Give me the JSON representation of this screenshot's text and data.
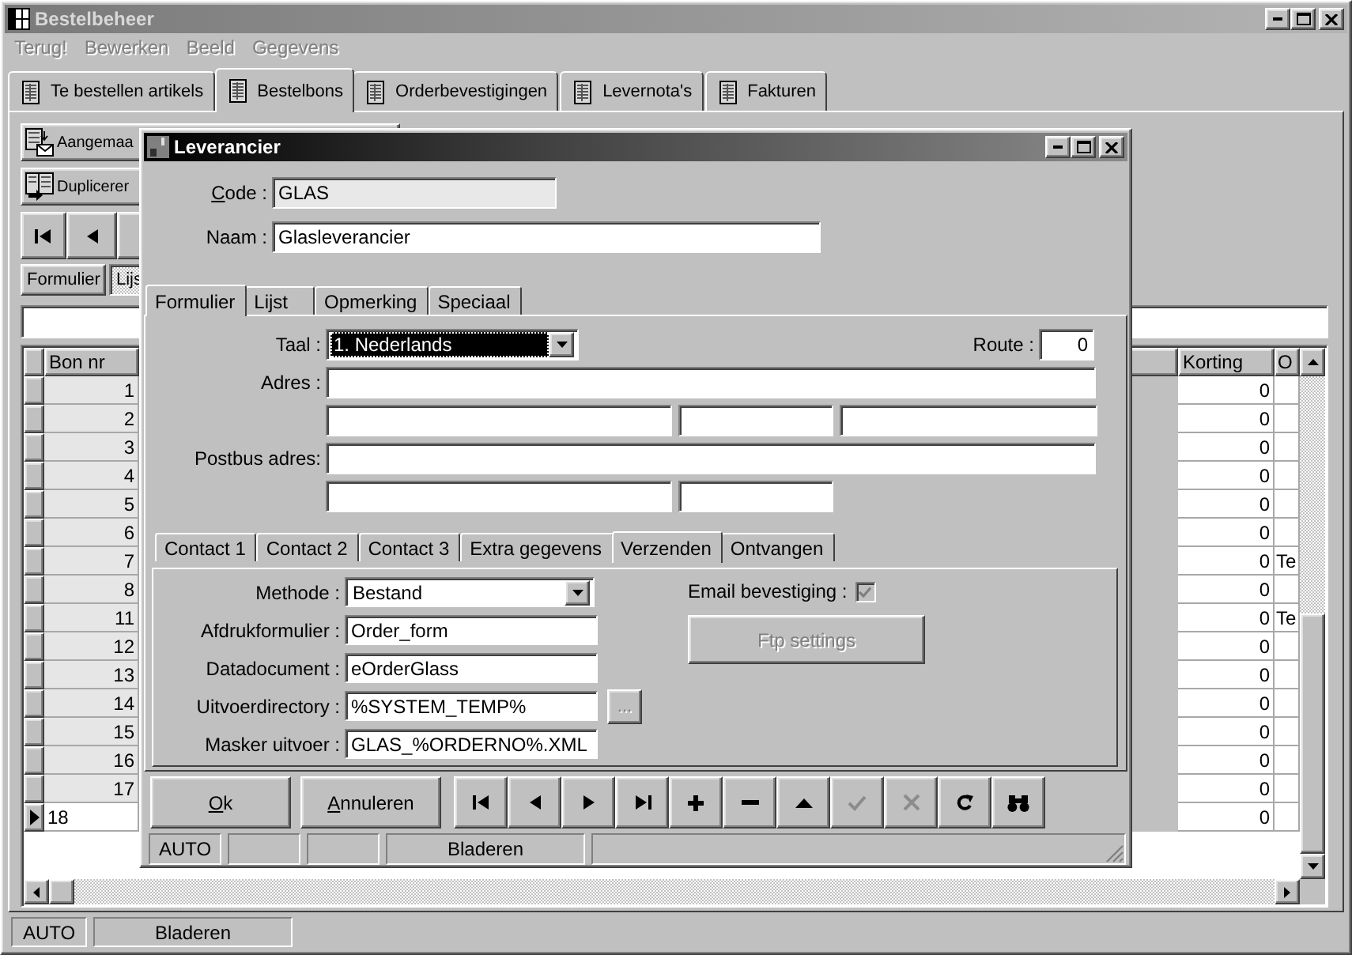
{
  "window": {
    "title": "Bestelbeheer",
    "active": false
  },
  "menu": [
    {
      "label": "Terug!",
      "disabled": true
    },
    {
      "label": "Bewerken",
      "disabled": true
    },
    {
      "label": "Beeld",
      "disabled": true
    },
    {
      "label": "Gegevens",
      "disabled": true
    }
  ],
  "tabs": [
    {
      "label": "Te bestellen artikels",
      "selected": false
    },
    {
      "label": "Bestelbons",
      "selected": true
    },
    {
      "label": "Orderbevestigingen",
      "selected": false
    },
    {
      "label": "Levernota's",
      "selected": false
    },
    {
      "label": "Fakturen",
      "selected": false
    }
  ],
  "toolbar": [
    {
      "kind": "create",
      "label": "Aangemaa"
    },
    {
      "kind": "duplicate",
      "label": "Duplicerer"
    }
  ],
  "record_nav": [
    {
      "kind": "first"
    },
    {
      "kind": "prev"
    }
  ],
  "view_tabs": [
    {
      "label": "Formulier",
      "selected": false
    },
    {
      "label": "Lijs",
      "selected": true
    }
  ],
  "grid": {
    "columns": [
      "Bon nr",
      "Korting",
      "O"
    ],
    "rows": [
      {
        "bon_nr": "1",
        "korting": "0",
        "current": false
      },
      {
        "bon_nr": "2",
        "korting": "0",
        "current": false
      },
      {
        "bon_nr": "3",
        "korting": "0",
        "current": false
      },
      {
        "bon_nr": "4",
        "korting": "0",
        "current": false
      },
      {
        "bon_nr": "5",
        "korting": "0",
        "current": false
      },
      {
        "bon_nr": "6",
        "korting": "0",
        "current": false
      },
      {
        "bon_nr": "7",
        "korting": "0",
        "column_3": "Te",
        "current": false
      },
      {
        "bon_nr": "8",
        "korting": "0",
        "current": false
      },
      {
        "bon_nr": "11",
        "korting": "0",
        "column_3": "Te",
        "current": false
      },
      {
        "bon_nr": "12",
        "korting": "0",
        "current": false
      },
      {
        "bon_nr": "13",
        "korting": "0",
        "current": false
      },
      {
        "bon_nr": "14",
        "korting": "0",
        "current": false
      },
      {
        "bon_nr": "15",
        "korting": "0",
        "current": false
      },
      {
        "bon_nr": "16",
        "korting": "0",
        "current": false
      },
      {
        "bon_nr": "17",
        "korting": "0",
        "current": false
      },
      {
        "bon_nr": "18",
        "korting": "0",
        "current": true
      }
    ]
  },
  "status_bar": {
    "mode": "AUTO",
    "state": "Bladeren"
  },
  "dialog": {
    "title": "Leverancier",
    "active": true,
    "code": {
      "label": "Code :",
      "value": "GLAS",
      "readonly": true,
      "mnemonic": true
    },
    "naam": {
      "label": "Naam :",
      "value": "Glasleverancier",
      "readonly": false,
      "mnemonic": false
    },
    "tabs": [
      {
        "label": "Formulier",
        "selected": true
      },
      {
        "label": "Lijst",
        "selected": false
      },
      {
        "label": "Opmerking",
        "selected": false
      },
      {
        "label": "Speciaal",
        "selected": false
      }
    ],
    "taal": {
      "label": "Taal :",
      "value": "1.  Nederlands",
      "focused": true
    },
    "route": {
      "label": "Route :",
      "value": "0"
    },
    "adres": {
      "label": "Adres :"
    },
    "postbus": {
      "label": "Postbus adres:"
    },
    "sub_tabs": [
      {
        "label": "Contact 1",
        "selected": false
      },
      {
        "label": "Contact 2",
        "selected": false
      },
      {
        "label": "Contact 3",
        "selected": false
      },
      {
        "label": "Extra gegevens",
        "selected": false
      },
      {
        "label": "Verzenden",
        "selected": true
      },
      {
        "label": "Ontvangen",
        "selected": false
      }
    ],
    "send_fields": [
      {
        "kind": "dropdown",
        "label": "Methode :",
        "value": "Bestand"
      },
      {
        "kind": "text",
        "label": "Afdrukformulier :",
        "value": "Order_form"
      },
      {
        "kind": "text",
        "label": "Datadocument :",
        "value": "eOrderGlass"
      },
      {
        "kind": "browse",
        "label": "Uitvoerdirectory :",
        "value": "%SYSTEM_TEMP%",
        "button": "...",
        "button_disabled": true
      },
      {
        "kind": "text",
        "label": "Masker uitvoer :",
        "value": "GLAS_%ORDERNO%.XML"
      }
    ],
    "email_bevestiging": {
      "label": "Email bevestiging :",
      "checked": true,
      "disabled": true
    },
    "ftp_button": {
      "label": "Ftp settings",
      "disabled": true
    },
    "ok_button": {
      "label": "Ok",
      "mnemonic": true
    },
    "cancel_button": {
      "label": "Annuleren",
      "mnemonic": true
    },
    "nav_buttons": [
      {
        "kind": "first",
        "disabled": false
      },
      {
        "kind": "prev",
        "disabled": false
      },
      {
        "kind": "next",
        "disabled": false
      },
      {
        "kind": "last",
        "disabled": false
      },
      {
        "kind": "add",
        "disabled": false
      },
      {
        "kind": "delete",
        "disabled": false
      },
      {
        "kind": "edit",
        "disabled": false
      },
      {
        "kind": "post",
        "disabled": true
      },
      {
        "kind": "cancel",
        "disabled": true
      },
      {
        "kind": "refresh",
        "disabled": false
      },
      {
        "kind": "search",
        "disabled": false
      }
    ],
    "status_bar": {
      "mode": "AUTO",
      "state": "Bladeren"
    }
  }
}
